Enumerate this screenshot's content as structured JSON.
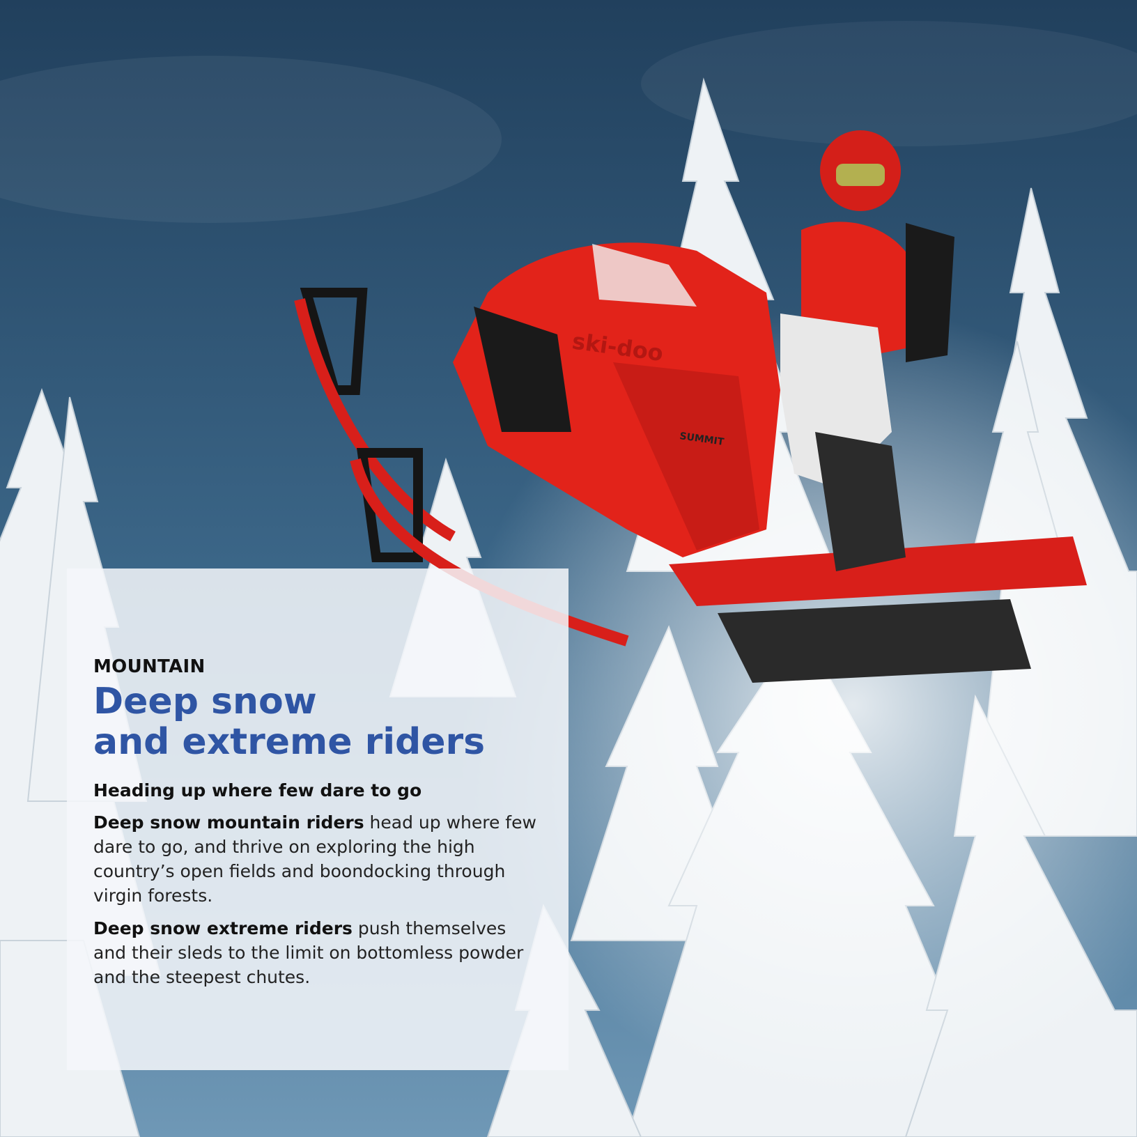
{
  "panel": {
    "eyebrow": "MOUNTAIN",
    "title_line1": "Deep snow",
    "title_line2": "and extreme riders",
    "subhead": "Heading up where few dare to go",
    "paragraphs": [
      {
        "lead": "Deep snow mountain riders",
        "text": " head up where few dare to go, and thrive on exploring the high country’s open fields and boondocking through virgin forests."
      },
      {
        "lead": "Deep snow extreme riders",
        "text": " push themselves and their sleds to the limit on bottomless powder and the steepest chutes."
      }
    ]
  },
  "sled": {
    "brand_text": "ski-doo",
    "model_text": "SUMMIT"
  },
  "colors": {
    "sky_top": "#254a6a",
    "sky_bottom": "#5a87a8",
    "sled_red": "#e2231a",
    "title_blue": "#2f55a4",
    "snow": "#f3f5f7"
  }
}
